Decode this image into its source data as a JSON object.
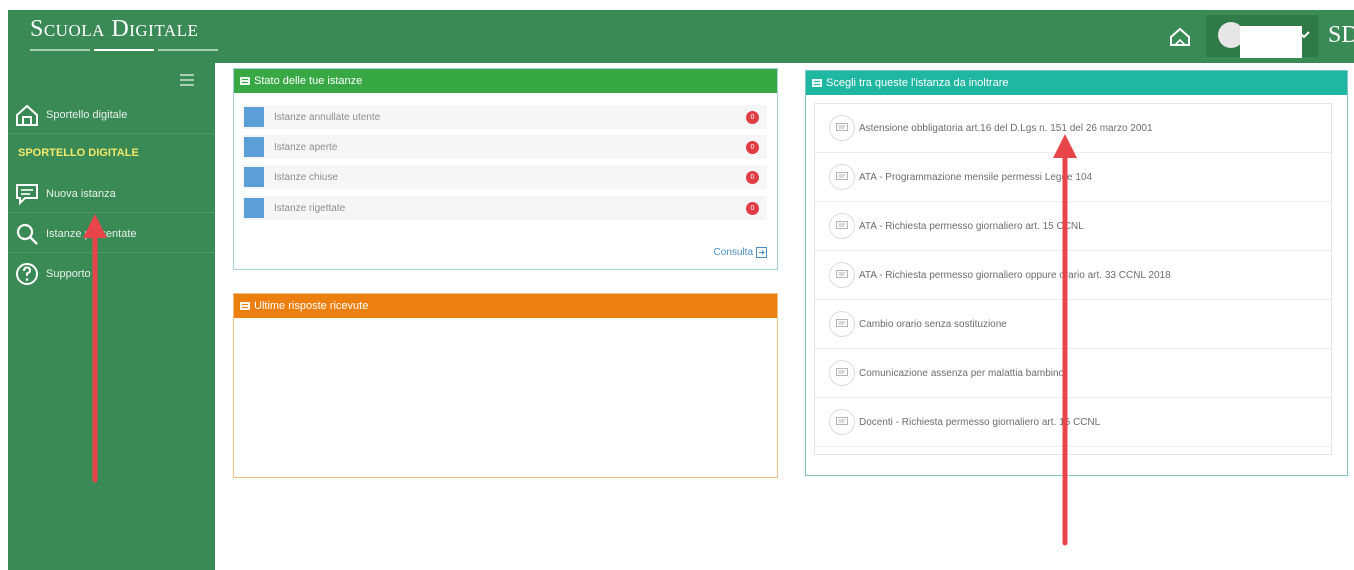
{
  "app": {
    "logo_text": "Scuola Digitale",
    "top_initials": "SD"
  },
  "sidebar": {
    "items": [
      {
        "label": "Sportello digitale",
        "icon": "home-outline-icon"
      },
      {
        "label": "Nuova istanza",
        "icon": "chat-bubble-icon"
      },
      {
        "label": "Istanze presentate",
        "icon": "search-icon"
      },
      {
        "label": "Supporto",
        "icon": "help-circle-icon"
      }
    ],
    "section_label": "SPORTELLO DIGITALE"
  },
  "stato": {
    "title": "Stato delle tue istanze",
    "rows": [
      {
        "label": "Istanze annullate utente",
        "count": "0"
      },
      {
        "label": "Istanze aperte",
        "count": "0"
      },
      {
        "label": "Istanze chiuse",
        "count": "0"
      },
      {
        "label": "Istanze rigettate",
        "count": "0"
      }
    ],
    "consulta_label": "Consulta"
  },
  "ultime": {
    "title": "Ultime risposte ricevute"
  },
  "scegli": {
    "title": "Scegli tra queste l'istanza da inoltrare",
    "items": [
      "Astensione obbligatoria art.16 del D.Lgs n. 151 del 26 marzo 2001",
      "ATA - Programmazione mensile permessi Legge 104",
      "ATA - Richiesta permesso giornaliero art. 15 CCNL",
      "ATA - Richiesta permesso giornaliero oppure orario art. 33 CCNL 2018",
      "Cambio orario senza sostituzione",
      "Comunicazione assenza per malattia bambino",
      "Docenti - Richiesta permesso giornaliero art. 15 CCNL"
    ]
  },
  "colors": {
    "brand_green": "#3a8a56",
    "stato_header": "#38a844",
    "ultime_header": "#ec7f0e",
    "scegli_header": "#1fb7a1",
    "badge": "#e03c44",
    "arrow": "#e8454b"
  }
}
